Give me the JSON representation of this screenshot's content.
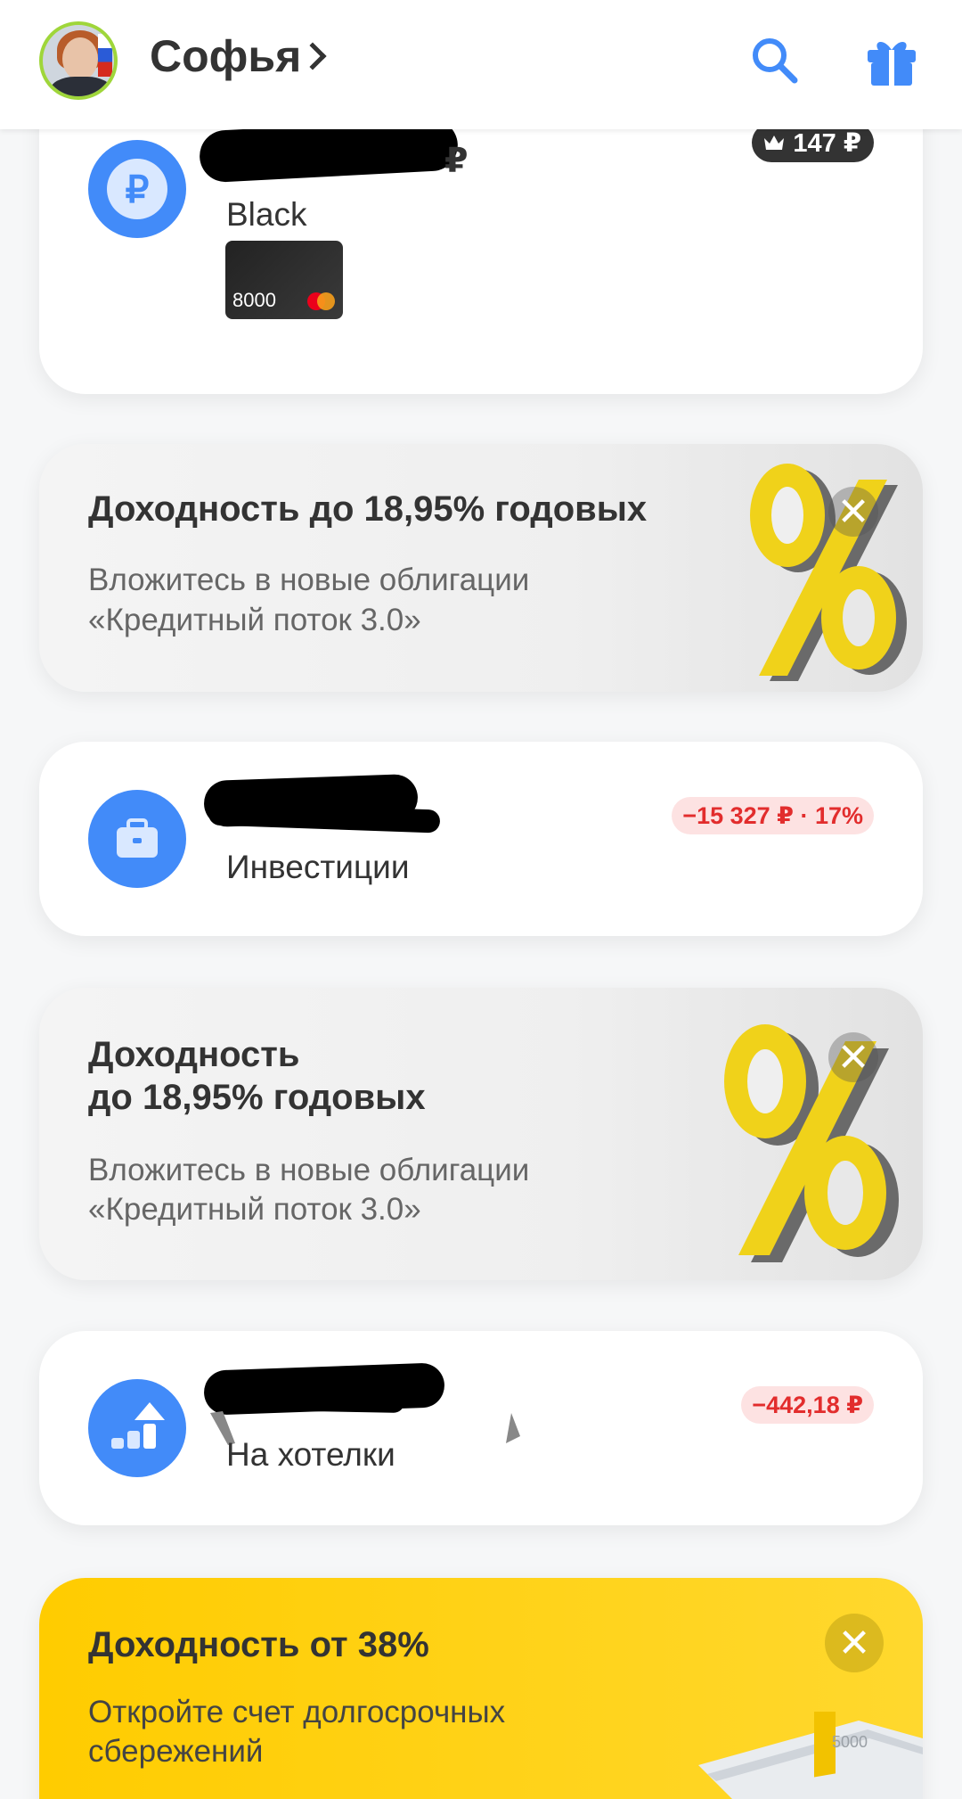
{
  "header": {
    "user_name": "Софья",
    "accent_color": "#428bf9",
    "avatar_icon": "user-avatar",
    "search_icon": "search-icon",
    "gift_icon": "gift-icon"
  },
  "accounts": [
    {
      "icon": "ruble-icon",
      "name": "Black",
      "currency_fragment": "₽",
      "cashback_badge": "147 ₽",
      "card_last_digits": "8000",
      "card_brand": "mastercard"
    },
    {
      "icon": "briefcase-icon",
      "name": "Инвестиции",
      "change_badge": "−15 327 ₽ · 17%"
    },
    {
      "icon": "savings-growth-icon",
      "name": "На хотелки",
      "change_badge": "−442,18 ₽"
    }
  ],
  "promos": [
    {
      "title": "Доходность до 18,95% годовых",
      "text_line1": "Вложитесь в новые облигации",
      "text_line2": "«Кредитный поток 3.0»",
      "close_label": "✕"
    },
    {
      "title_line1": "Доходность",
      "title_line2": "до 18,95% годовых",
      "text_line1": "Вложитесь в новые облигации",
      "text_line2": "«Кредитный поток 3.0»",
      "close_label": "✕"
    },
    {
      "title": "Доходность от 38%",
      "text_line1": "Откройте счет долгосрочных",
      "text_line2": "сбережений",
      "close_label": "✕",
      "banknote_text": "5000"
    }
  ],
  "colors": {
    "negative": "#e22d2d",
    "negative_bg": "#fde2e2",
    "promo_yellow": "#ffd82e"
  }
}
